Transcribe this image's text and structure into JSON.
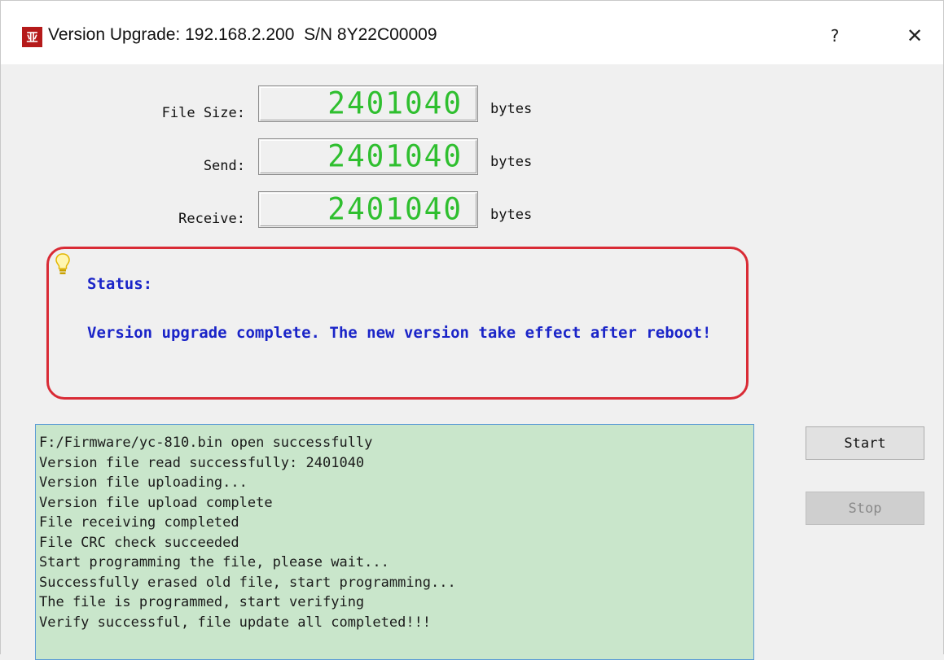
{
  "window": {
    "title": "Version Upgrade: 192.168.2.200  S/N 8Y22C00009",
    "icon": "app-logo-icon",
    "help_glyph": "?",
    "close_glyph": "✕"
  },
  "counters": [
    {
      "label": "File Size:",
      "value": "2401040",
      "unit": "bytes"
    },
    {
      "label": "Send:",
      "value": "2401040",
      "unit": "bytes"
    },
    {
      "label": "Receive:",
      "value": "2401040",
      "unit": "bytes"
    }
  ],
  "status": {
    "icon": "lightbulb-icon",
    "label": "Status:",
    "message": "Version upgrade complete. The new version take effect after reboot!",
    "border_color": "#d92b35",
    "text_color": "#1a24c8"
  },
  "log": {
    "background": "#c9e6cb",
    "lines": [
      "F:/Firmware/yc-810.bin open successfully",
      "Version file read successfully: 2401040",
      "Version file uploading...",
      "Version file upload complete",
      "File receiving completed",
      "File CRC check succeeded",
      "Start programming the file, please wait...",
      "Successfully erased old file, start programming...",
      "The file is programmed, start verifying",
      "Verify successful, file update all completed!!!"
    ]
  },
  "buttons": {
    "start_label": "Start",
    "stop_label": "Stop",
    "stop_enabled": false
  },
  "colors": {
    "lcd_digits": "#2fbf2f"
  }
}
